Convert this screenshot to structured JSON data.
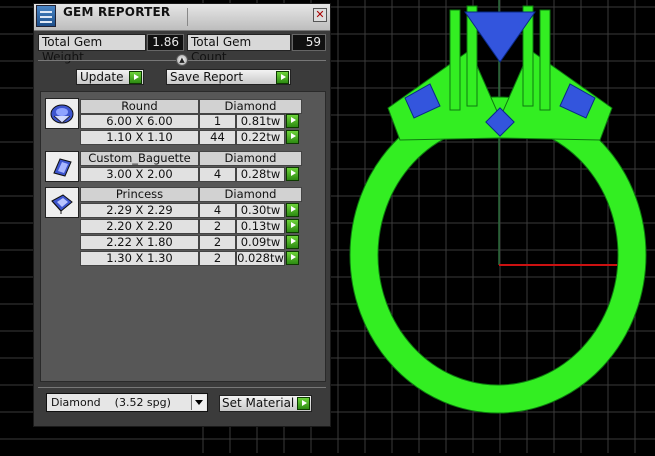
{
  "panel": {
    "title": "GEM REPORTER",
    "close_glyph": "✕",
    "total_weight_label": "Total Gem Weight",
    "total_weight_value": "1.86",
    "total_count_label": "Total Gem Count",
    "total_count_value": "59",
    "splitter_glyph": "▲",
    "update_label": "Update",
    "save_report_label": "Save Report"
  },
  "gem_groups": [
    {
      "icon": "round-gem-icon",
      "shape": "Round",
      "material": "Diamond",
      "rows": [
        {
          "size": "6.00 X 6.00",
          "count": "1",
          "weight": "0.81tw"
        },
        {
          "size": "1.10 X 1.10",
          "count": "44",
          "weight": "0.22tw"
        }
      ]
    },
    {
      "icon": "baguette-gem-icon",
      "shape": "Custom_Baguette",
      "material": "Diamond",
      "rows": [
        {
          "size": "3.00 X 2.00",
          "count": "4",
          "weight": "0.28tw"
        }
      ]
    },
    {
      "icon": "princess-gem-icon",
      "shape": "Princess",
      "material": "Diamond",
      "rows": [
        {
          "size": "2.29 X 2.29",
          "count": "4",
          "weight": "0.30tw"
        },
        {
          "size": "2.20 X 2.20",
          "count": "2",
          "weight": "0.13tw"
        },
        {
          "size": "2.22 X 1.80",
          "count": "2",
          "weight": "0.09tw"
        },
        {
          "size": "1.30 X 1.30",
          "count": "2",
          "weight": "0.028tw"
        }
      ]
    }
  ],
  "material": {
    "selected": "Diamond    (3.52 spg)",
    "set_label": "Set Material"
  },
  "colors": {
    "ring": "#33ee22",
    "gem": "#3355dd",
    "grid": "#3a3a3a",
    "axis_x": "#cc1111",
    "arrow_button": "#44b020"
  }
}
